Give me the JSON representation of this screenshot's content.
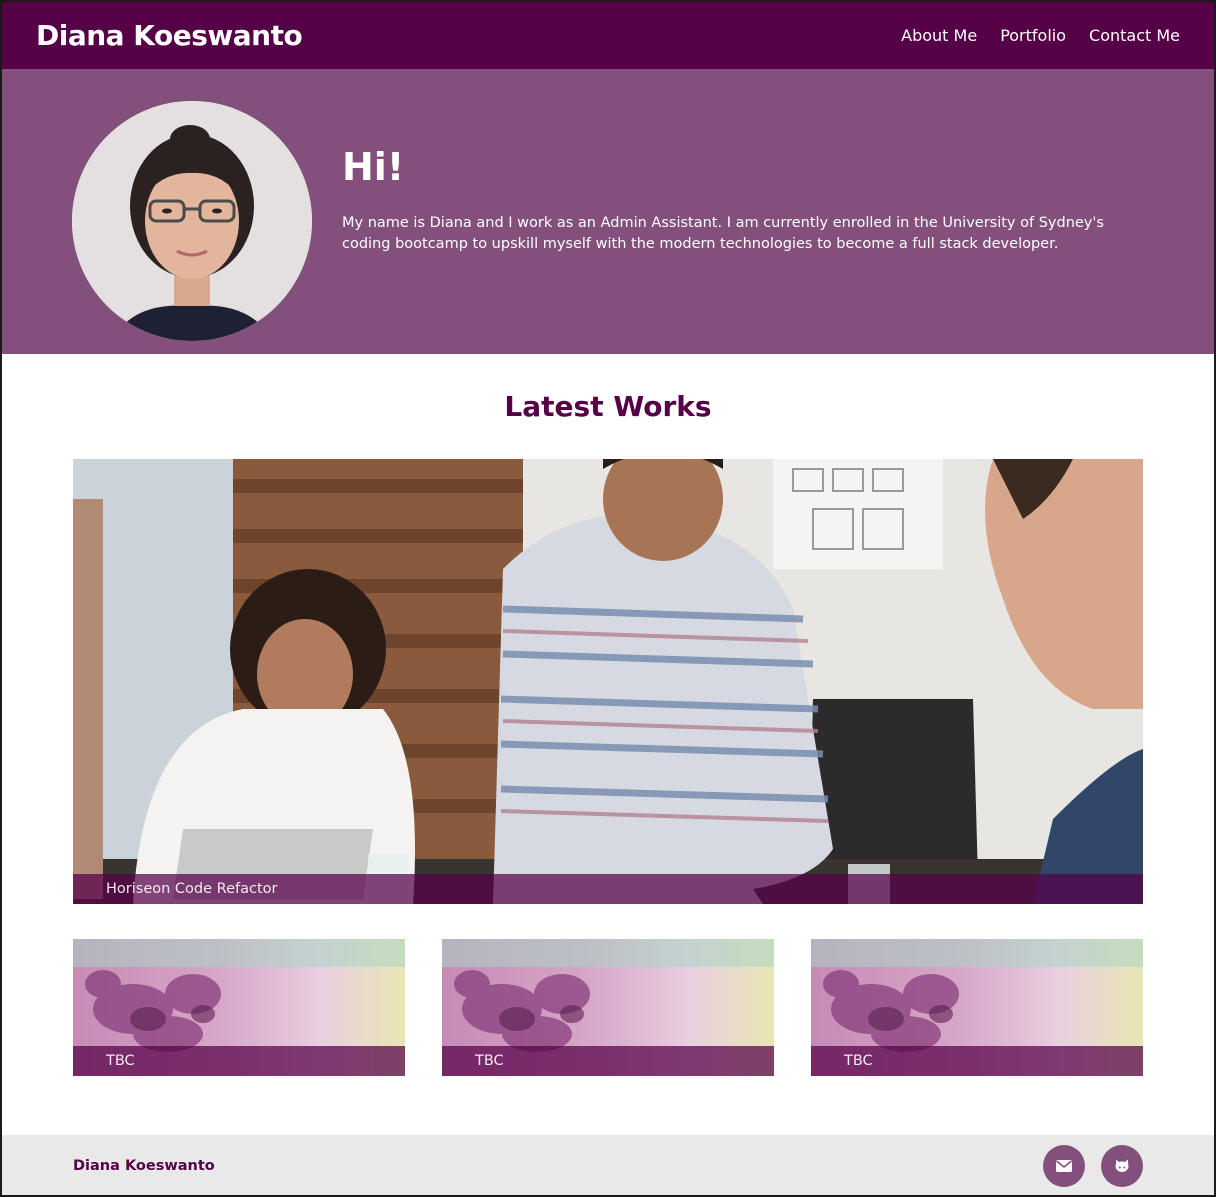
{
  "header": {
    "brand": "Diana Koeswanto",
    "nav": [
      {
        "label": "About Me"
      },
      {
        "label": "Portfolio"
      },
      {
        "label": "Contact Me"
      }
    ]
  },
  "hero": {
    "greeting": "Hi!",
    "bio": "My name is Diana and I work as an Admin Assistant. I am currently enrolled in the University of Sydney's coding bootcamp to upskill myself with the modern technologies to become a full stack developer."
  },
  "works": {
    "title": "Latest Works",
    "featured": {
      "caption": "Horiseon Code Refactor"
    },
    "tiles": [
      {
        "caption": "TBC"
      },
      {
        "caption": "TBC"
      },
      {
        "caption": "TBC"
      }
    ]
  },
  "footer": {
    "name": "Diana Koeswanto",
    "icons": [
      "envelope-icon",
      "github-icon"
    ]
  },
  "colors": {
    "brand_dark": "#560048",
    "brand_mid": "#83507c",
    "footer_bg": "#e9e9e9"
  }
}
